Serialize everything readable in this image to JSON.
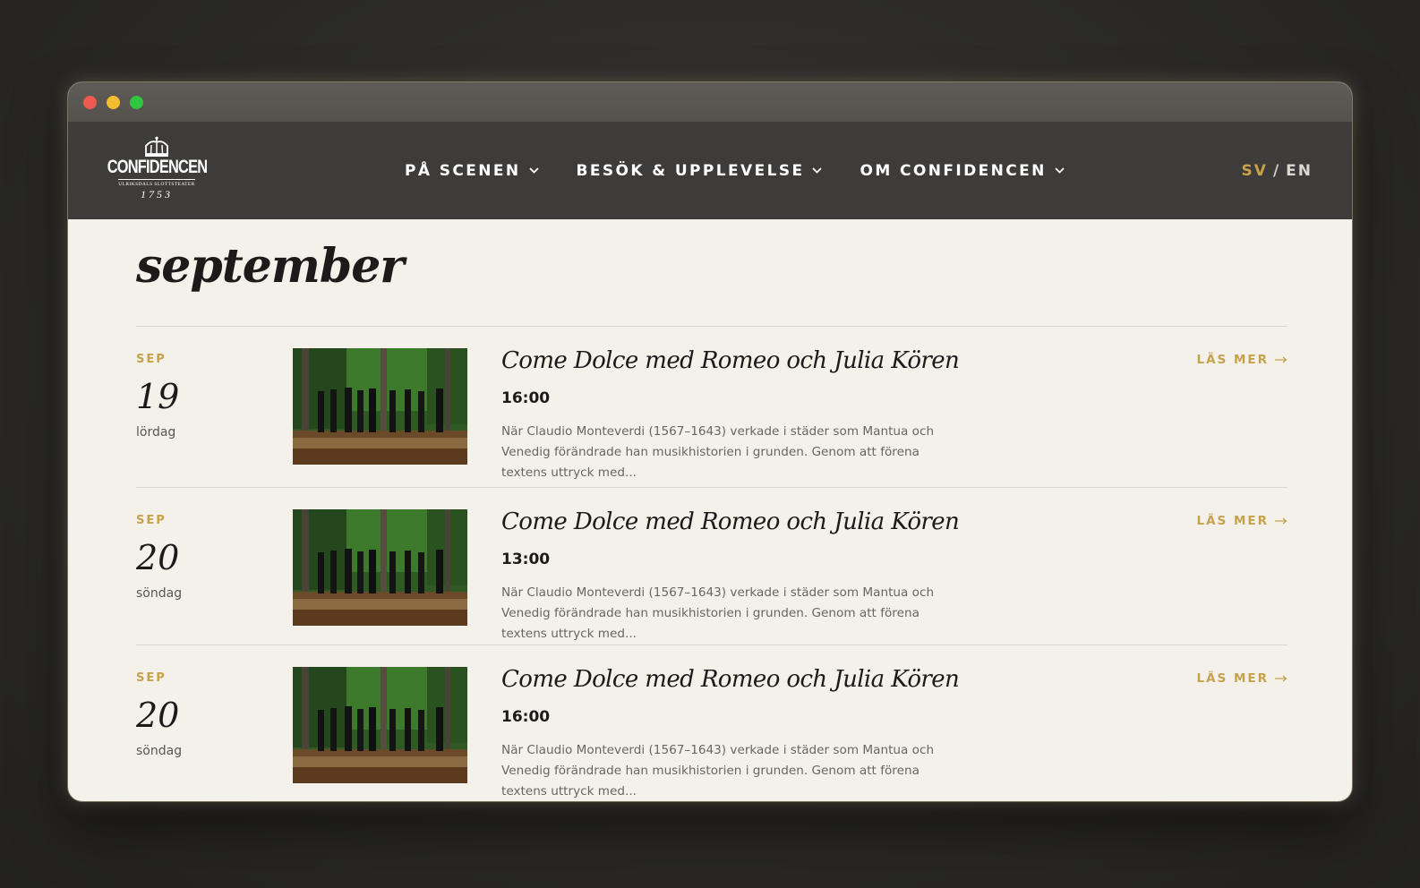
{
  "colors": {
    "accent": "#c6a24a",
    "nav_bg": "#3d3c3b",
    "page_bg": "#f4f0ea"
  },
  "logo": {
    "word": "CONFIDENCEN",
    "sub": "ULRIKSDALS SLOTTSTEATER",
    "year": "1753"
  },
  "nav": {
    "items": [
      {
        "label": "PÅ SCENEN"
      },
      {
        "label": "BESÖK & UPPLEVELSE"
      },
      {
        "label": "OM CONFIDENCEN"
      }
    ],
    "lang": {
      "sv": "SV",
      "separator": "/",
      "en": "EN",
      "active": "SV"
    }
  },
  "month_heading": "september",
  "events": [
    {
      "month": "SEP",
      "day": "19",
      "weekday": "lördag",
      "title": "Come Dolce med Romeo och Julia Kören",
      "time": "16:00",
      "description": "När Claudio Monteverdi (1567–1643) verkade i städer som Mantua och Venedig förändrade han musikhistorien i grunden. Genom att förena textens uttryck med...",
      "read_more": "LÄS MER"
    },
    {
      "month": "SEP",
      "day": "20",
      "weekday": "söndag",
      "title": "Come Dolce med Romeo och Julia Kören",
      "time": "13:00",
      "description": "När Claudio Monteverdi (1567–1643) verkade i städer som Mantua och Venedig förändrade han musikhistorien i grunden. Genom att förena textens uttryck med...",
      "read_more": "LÄS MER"
    },
    {
      "month": "SEP",
      "day": "20",
      "weekday": "söndag",
      "title": "Come Dolce med Romeo och Julia Kören",
      "time": "16:00",
      "description": "När Claudio Monteverdi (1567–1643) verkade i städer som Mantua och Venedig förändrade han musikhistorien i grunden. Genom att förena textens uttryck med...",
      "read_more": "LÄS MER"
    }
  ]
}
